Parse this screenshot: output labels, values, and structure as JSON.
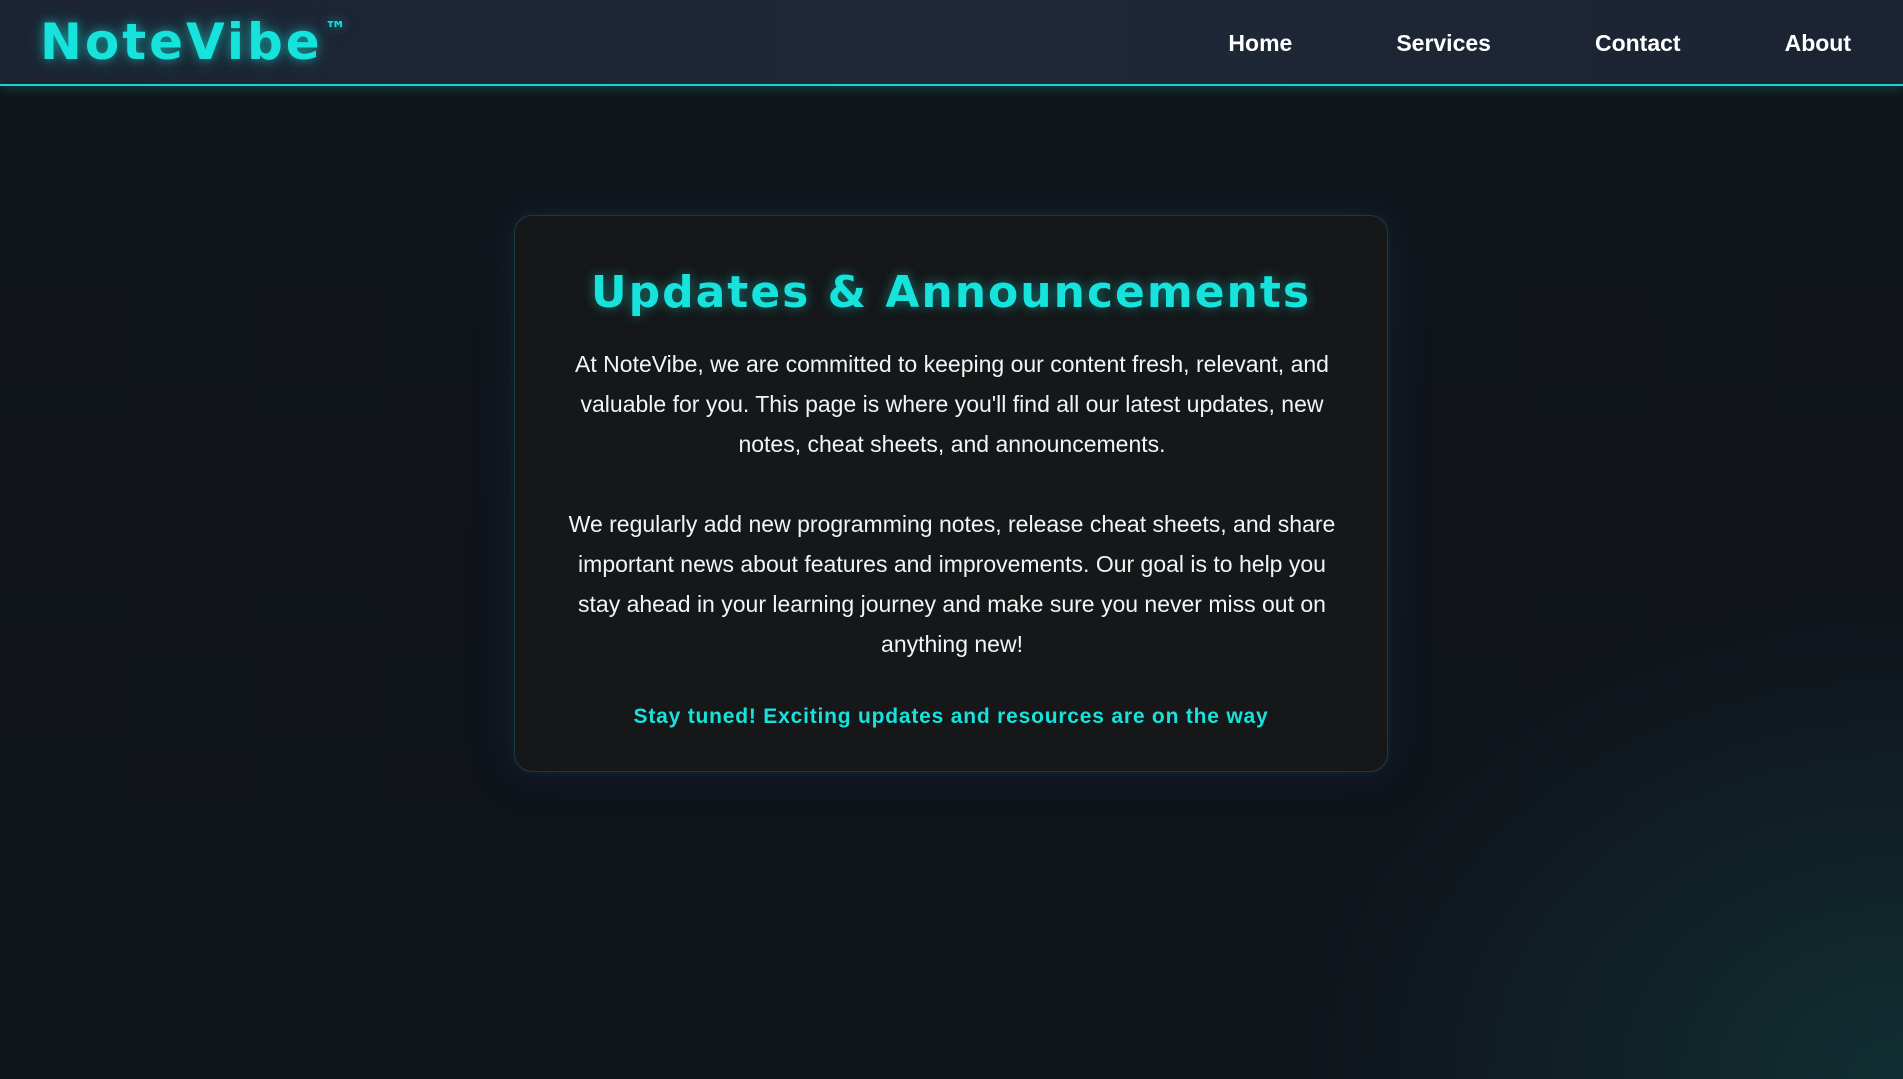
{
  "header": {
    "logo": "NoteVibe",
    "logo_trademark": "™",
    "nav": [
      {
        "label": "Home"
      },
      {
        "label": "Services"
      },
      {
        "label": "Contact"
      },
      {
        "label": "About"
      }
    ]
  },
  "main": {
    "title": "Updates & Announcements",
    "paragraphs": [
      "At NoteVibe, we are committed to keeping our content fresh, relevant, and valuable for you. This page is where you'll find all our latest updates, new notes, cheat sheets, and announcements.",
      "We regularly add new programming notes, release cheat sheets, and share important news about features and improvements. Our goal is to help you stay ahead in your learning journey and make sure you never miss out on anything new!"
    ],
    "tagline": "Stay tuned! Exciting updates and resources are on the way"
  },
  "colors": {
    "accent": "#16e3dc",
    "background": "#0f131a",
    "header_background": "#1f2838",
    "card_background": "#151719",
    "text": "#f2f4f5"
  }
}
